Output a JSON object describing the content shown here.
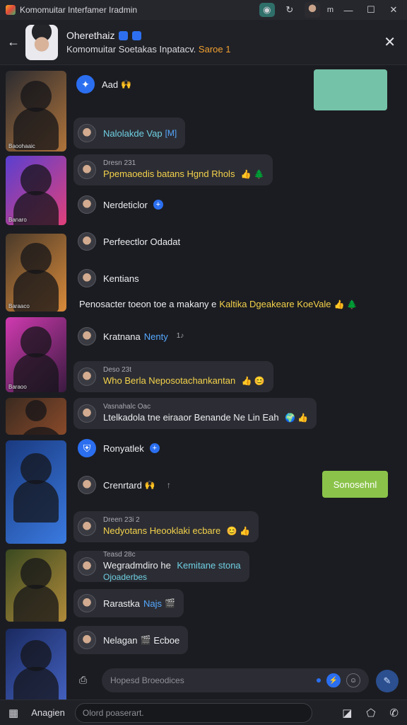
{
  "window": {
    "title": "Komomuitar Interfamer Iradmin",
    "m_label": "m",
    "icons": [
      "app-icon",
      "chat-icon",
      "refresh-icon",
      "minimize-icon",
      "maximize-icon",
      "close-icon"
    ]
  },
  "header": {
    "name": "Oherethaiz",
    "subtitle": "Komomuitar Soetakas Inpatacv.",
    "subtitle_accent": "Saroe 1"
  },
  "thumbnails": [
    {
      "caption": "Baoohaaic",
      "colors": [
        "#2b2b30",
        "#b0743a"
      ]
    },
    {
      "caption": "Banaro",
      "colors": [
        "#5a3fd0",
        "#e0407a"
      ]
    },
    {
      "caption": "Baraaco",
      "colors": [
        "#4a3a2a",
        "#d98a3a"
      ]
    },
    {
      "caption": "Baraoo",
      "colors": [
        "#d03ab0",
        "#3a1a40"
      ]
    },
    {
      "caption": "",
      "colors": [
        "#3a2a20",
        "#8a4a2a"
      ]
    },
    {
      "caption": "",
      "colors": [
        "#1a3a80",
        "#3a7ae0"
      ]
    },
    {
      "caption": "",
      "colors": [
        "#3a4a20",
        "#b08a3a"
      ]
    },
    {
      "caption": "",
      "colors": [
        "#1a2a60",
        "#4a6ad0"
      ]
    }
  ],
  "messages": [
    {
      "text": "Aad",
      "emoji": "🙌"
    },
    {
      "text": "Nalolakde Vap",
      "tag": "[M]"
    },
    {
      "meta": "Dresn 231",
      "text": "Ppemaoedis batans Hgnd Rhols",
      "emoji": "👍 🌲"
    },
    {
      "text": "Nerdeticlor"
    },
    {
      "text": "Perfeectlor Odadat"
    },
    {
      "text": "Kentians"
    },
    {
      "text": "Penosacter toeon toe a makany e",
      "accent": "Kaltika Dgeakeare KoeVale",
      "emoji": "👍 🌲"
    },
    {
      "text": "Kratnana",
      "accent": "Nenty",
      "extra": "1♪"
    },
    {
      "meta": "Deso 23t",
      "text": "Who Berla Neposotachankantan",
      "emoji": "👍 😊"
    },
    {
      "meta": "Vasnahalc Oac",
      "text": "Ltelkadola tne eiraaor Benande Ne Lin Eah",
      "emoji": "🌍 👍"
    },
    {
      "text": "Ronyatlek"
    },
    {
      "text": "Crenrtard",
      "emoji": "🙌",
      "extra": "↑"
    },
    {
      "meta": "Dreen 23i  2",
      "text": "Nedyotans Heooklaki ecbare",
      "emoji": "😊 👍"
    },
    {
      "meta": "Teasd 28c",
      "text": "Wegradmdiro he",
      "accent": "Kemitane stona",
      "line2": "Ojoaderbes"
    },
    {
      "text": "Rarastka",
      "accent": "Najs",
      "emoji": "🎬"
    },
    {
      "text": "Nelagan",
      "accent": "🎬",
      "text2": "Ecboe"
    }
  ],
  "actions": {
    "green_button": "Sonosehnl"
  },
  "composer": {
    "placeholder": "Hopesd Broeodices"
  },
  "bottombar": {
    "label": "Anagien",
    "placeholder": "Olord poaserart."
  }
}
